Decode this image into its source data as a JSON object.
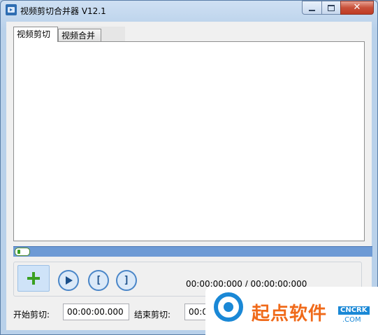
{
  "window": {
    "title": "视频剪切合并器 V12.1",
    "close_symbol": "✕"
  },
  "tabs": [
    {
      "label": "视频剪切",
      "active": true
    },
    {
      "label": "视频合并",
      "active": false
    }
  ],
  "player": {
    "time_display": "00:00:00:000 / 00:00:00:000",
    "progress": 0
  },
  "controls": {
    "add_icon": "plus-icon",
    "play_icon": "play-icon",
    "mark_in_glyph": "[",
    "mark_out_glyph": "]"
  },
  "cut": {
    "start_label": "开始剪切:",
    "start_value": "00:00:00.000",
    "end_label": "结束剪切:",
    "end_value": "00:00"
  },
  "watermark": {
    "text": "起点软件",
    "badge": "CNCRK",
    "domain": ".COM"
  },
  "colors": {
    "accent": "#6d9ad5",
    "add_icon": "#3aa021",
    "watermark_orange": "#f06a1a",
    "watermark_blue": "#1a88d6"
  }
}
